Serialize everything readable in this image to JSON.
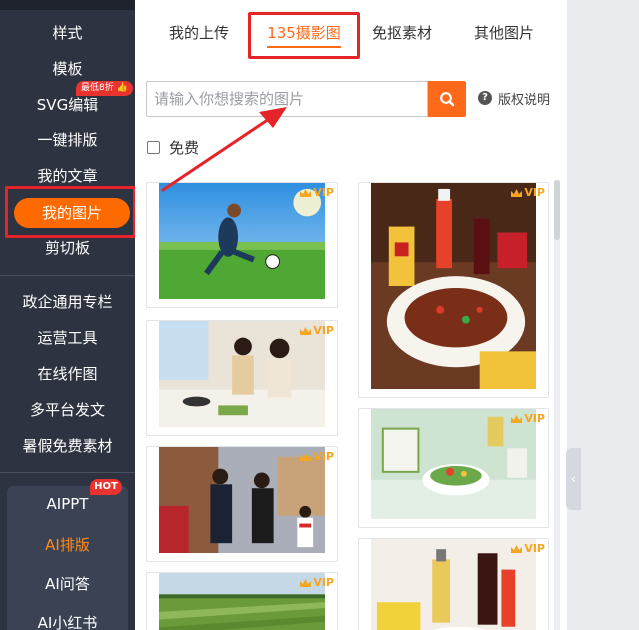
{
  "sidebar": {
    "items": [
      {
        "label": "样式"
      },
      {
        "label": "模板"
      },
      {
        "label": "SVG编辑"
      },
      {
        "label": "一键排版"
      },
      {
        "label": "我的文章"
      },
      {
        "label": "我的图片"
      },
      {
        "label": "剪切板"
      },
      {
        "label": "政企通用专栏"
      },
      {
        "label": "运营工具"
      },
      {
        "label": "在线作图"
      },
      {
        "label": "多平台发文"
      },
      {
        "label": "暑假免费素材"
      },
      {
        "label": "AIPPT"
      },
      {
        "label": "AI排版"
      },
      {
        "label": "AI问答"
      },
      {
        "label": "AI小红书"
      }
    ],
    "discount_badge": "最低8折",
    "hot_badge": "HOT",
    "active_item": "我的图片"
  },
  "tabs": [
    {
      "label": "我的上传"
    },
    {
      "label": "135摄影图"
    },
    {
      "label": "免抠素材"
    },
    {
      "label": "其他图片"
    }
  ],
  "active_tab": "135摄影图",
  "search": {
    "placeholder": "请输入你想搜索的图片",
    "value": ""
  },
  "copyright_label": "版权说明",
  "free_filter": {
    "label": "免费",
    "checked": false
  },
  "vip_label": "VIP",
  "images": [
    {
      "icon": "soccer-photo",
      "vip": true
    },
    {
      "icon": "cooking-couple-photo",
      "vip": true
    },
    {
      "icon": "business-handshake-photo",
      "vip": true
    },
    {
      "icon": "farm-field-photo",
      "vip": true
    },
    {
      "icon": "sichuan-beef-photo",
      "vip": true
    },
    {
      "icon": "salad-gift-photo",
      "vip": true
    },
    {
      "icon": "condiment-bottles-photo",
      "vip": true
    }
  ],
  "colors": {
    "sidebar_bg": "#2d3340",
    "accent": "#ff6a1a",
    "highlight_red": "#e5242a",
    "vip_gold": "#f5a623"
  }
}
